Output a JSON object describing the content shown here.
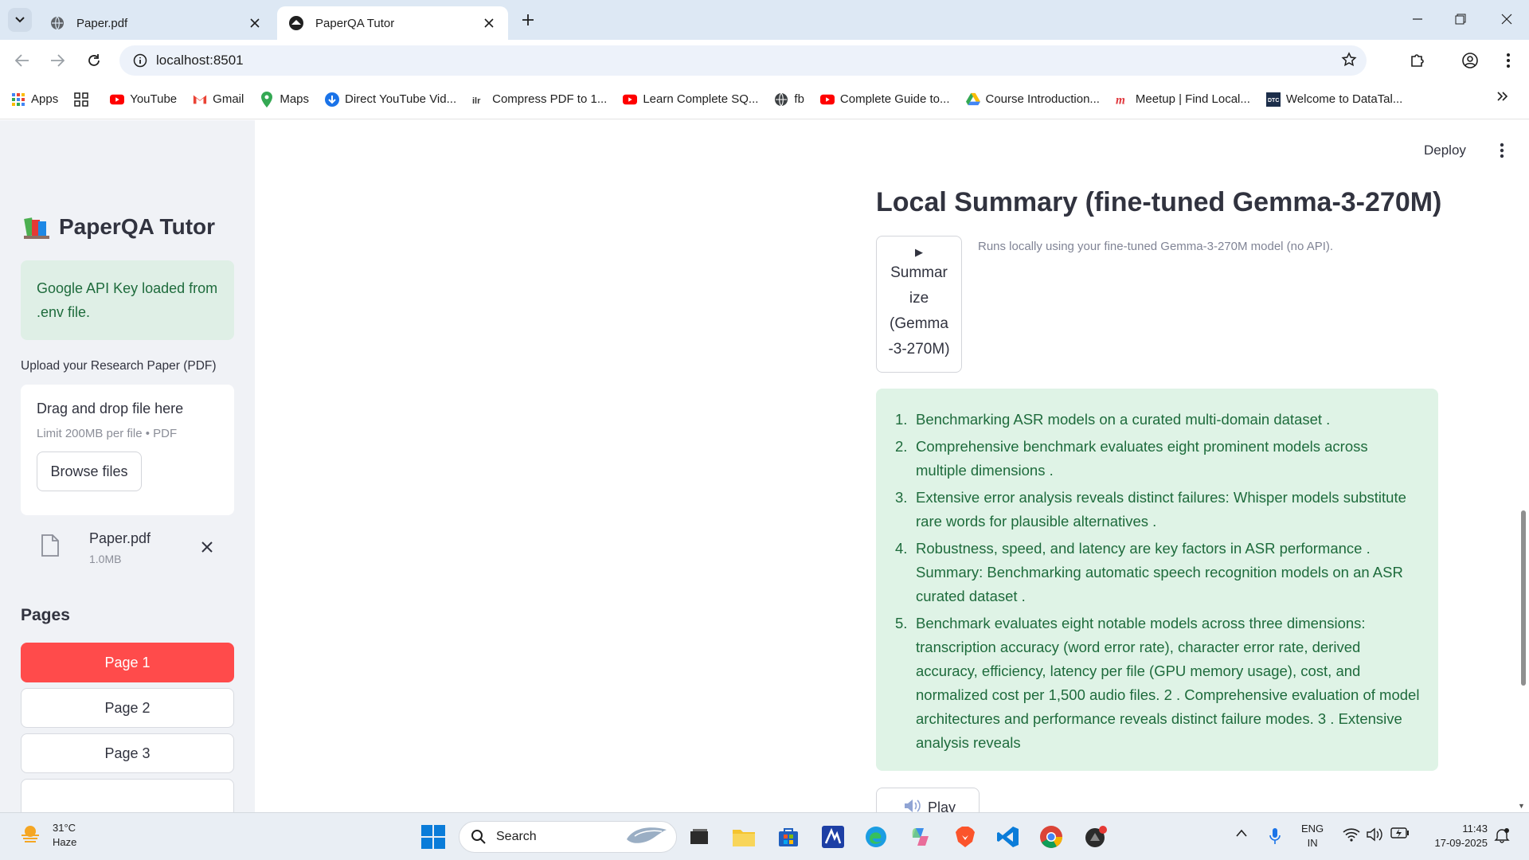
{
  "browser": {
    "tabs": [
      {
        "title": "Paper.pdf",
        "active": false
      },
      {
        "title": "PaperQA Tutor",
        "active": true
      }
    ],
    "url": "localhost:8501",
    "bookmarks": [
      {
        "label": "Apps",
        "icon": "apps-grid-icon"
      },
      {
        "label": "",
        "icon": "tab-groups-icon"
      },
      {
        "label": "YouTube",
        "icon": "youtube-icon"
      },
      {
        "label": "Gmail",
        "icon": "gmail-icon"
      },
      {
        "label": "Maps",
        "icon": "maps-icon"
      },
      {
        "label": "Direct YouTube Vid...",
        "icon": "download-icon"
      },
      {
        "label": "Compress PDF to 1...",
        "icon": "pdf-icon"
      },
      {
        "label": "Learn Complete SQ...",
        "icon": "youtube-icon"
      },
      {
        "label": "fb",
        "icon": "globe-icon"
      },
      {
        "label": "Complete Guide to...",
        "icon": "youtube-icon"
      },
      {
        "label": "Course Introduction...",
        "icon": "drive-icon"
      },
      {
        "label": "Meetup | Find Local...",
        "icon": "meetup-icon"
      },
      {
        "label": "Welcome to DataTal...",
        "icon": "datatalks-icon"
      }
    ]
  },
  "app": {
    "sidebar": {
      "title": "PaperQA Tutor",
      "alert": "Google API Key loaded from .env file.",
      "upload_label": "Upload your Research Paper (PDF)",
      "dropzone_title": "Drag and drop file here",
      "dropzone_limit": "Limit 200MB per file • PDF",
      "browse_label": "Browse files",
      "file": {
        "name": "Paper.pdf",
        "size": "1.0MB"
      },
      "pages_heading": "Pages",
      "pages": [
        "Page 1",
        "Page 2",
        "Page 3"
      ]
    },
    "header": {
      "deploy_label": "Deploy"
    },
    "main": {
      "heading": "Local Summary (fine-tuned Gemma-3-270M)",
      "summarize_button": "Summar\nize\n(Gemma\n-3-270M)",
      "caption": "Runs locally using your fine-tuned Gemma-3-270M model (no API).",
      "summary_items": [
        "Benchmarking ASR models on a curated multi-domain dataset .",
        "Comprehensive benchmark evaluates eight prominent models across multiple dimensions .",
        "Extensive error analysis reveals distinct failures: Whisper models substitute rare words for plausible alternatives .",
        "Robustness, speed, and latency are key factors in ASR performance . Summary: Benchmarking automatic speech recognition models on an ASR curated dataset .",
        "Benchmark evaluates eight notable models across three dimensions: transcription accuracy (word error rate), character error rate, derived accuracy, efficiency, latency per file (GPU memory usage), cost, and normalized cost per 1,500 audio files. 2 . Comprehensive evaluation of model architectures and performance reveals distinct failure modes. 3 . Extensive analysis reveals"
      ],
      "play_label": "Play"
    }
  },
  "taskbar": {
    "weather_temp": "31°C",
    "weather_desc": "Haze",
    "search_placeholder": "Search",
    "lang_top": "ENG",
    "lang_bottom": "IN",
    "time": "11:43",
    "date": "17-09-2025"
  },
  "colors": {
    "primary": "#ff4b4b",
    "success_bg": "#dff3e6",
    "success_text": "#1e6b3c",
    "sidebar_bg": "#f0f2f6"
  }
}
